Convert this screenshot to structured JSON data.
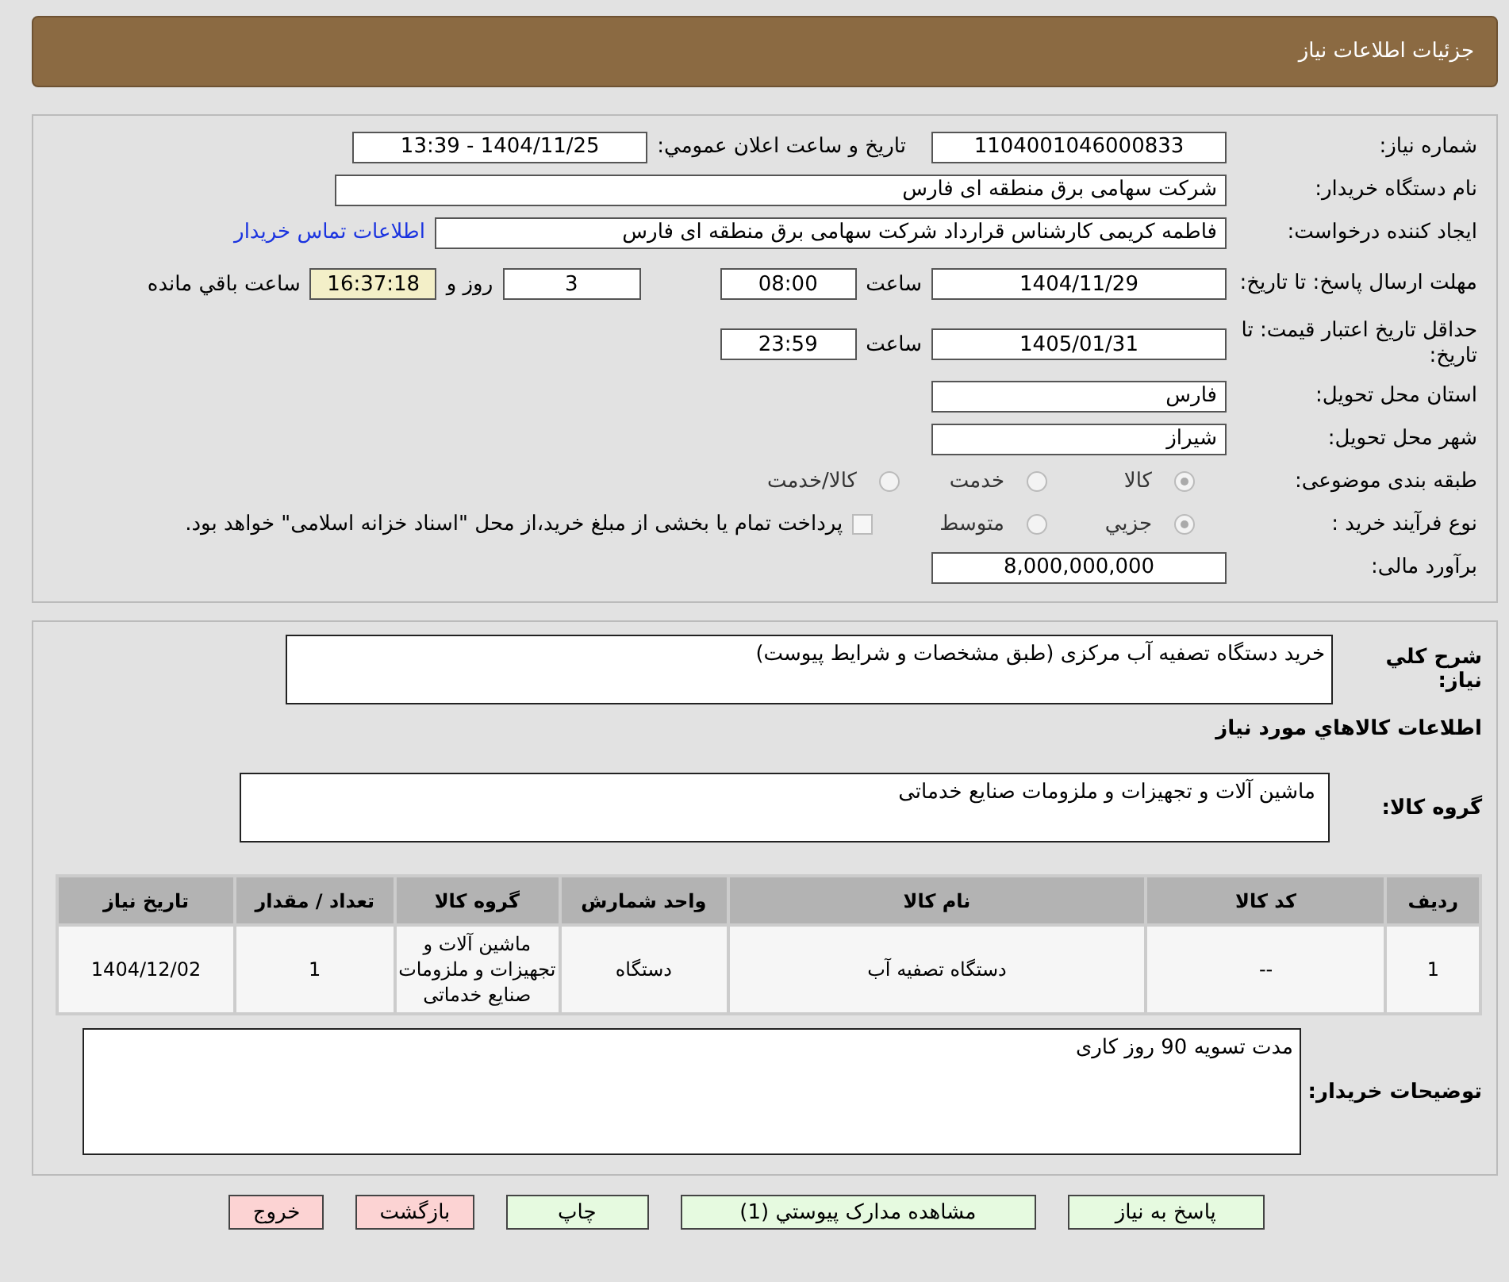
{
  "header": {
    "title": "جزئیات اطلاعات نیاز"
  },
  "need_number": {
    "label": "شماره نیاز:",
    "value": "1104001046000833"
  },
  "announce": {
    "label": "تاريخ و ساعت اعلان عمومي:",
    "value": "1404/11/25 - 13:39"
  },
  "buyer": {
    "label": "نام دستگاه خریدار:",
    "value": "شرکت سهامی برق منطقه ای فارس"
  },
  "creator": {
    "label": "ایجاد کننده درخواست:",
    "value": "فاطمه کریمی کارشناس قرارداد شرکت سهامی برق منطقه ای فارس",
    "link": "اطلاعات تماس خریدار"
  },
  "deadline": {
    "label": "مهلت ارسال پاسخ: تا تاریخ:",
    "date": "1404/11/29",
    "time_label": "ساعت",
    "time": "08:00",
    "days": "3",
    "days_label": "روز و",
    "remaining": "16:37:18",
    "remaining_label": "ساعت باقي مانده"
  },
  "validity": {
    "label": "حداقل تاریخ اعتبار قیمت: تا تاریخ:",
    "date": "1405/01/31",
    "time_label": "ساعت",
    "time": "23:59"
  },
  "province": {
    "label": "استان محل تحویل:",
    "value": "فارس"
  },
  "city": {
    "label": "شهر محل تحویل:",
    "value": "شیراز"
  },
  "category": {
    "label": "طبقه بندی موضوعی:",
    "options": [
      {
        "label": "کالا",
        "selected": true
      },
      {
        "label": "خدمت",
        "selected": false
      },
      {
        "label": "کالا/خدمت",
        "selected": false
      }
    ]
  },
  "process": {
    "label": "نوع فرآیند خرید :",
    "options": [
      {
        "label": "جزيي",
        "selected": true
      },
      {
        "label": "متوسط",
        "selected": false
      }
    ],
    "payment": {
      "checked": false,
      "text": "پرداخت تمام یا بخشی از مبلغ خرید،از محل \"اسناد خزانه اسلامی\" خواهد بود."
    }
  },
  "budget": {
    "label": "برآورد مالی:",
    "value": "8,000,000,000"
  },
  "description": {
    "label": "شرح كلي نياز:",
    "value": "خرید دستگاه تصفیه آب مرکزی (طبق مشخصات و شرایط پیوست)"
  },
  "goods_heading": "اطلاعات كالاهاي مورد نياز",
  "goods_group": {
    "label": "گروه کالا:",
    "value": "ماشین آلات و تجهیزات و ملزومات صنایع خدماتی"
  },
  "table": {
    "columns": [
      "ردیف",
      "کد کالا",
      "نام کالا",
      "واحد شمارش",
      "گروه کالا",
      "تعداد / مقدار",
      "تاریخ نیاز"
    ],
    "rows": [
      [
        "1",
        "--",
        "دستگاه تصفیه آب",
        "دستگاه",
        "ماشین آلات و تجهیزات و ملزومات صنایع خدماتی",
        "1",
        "1404/12/02"
      ]
    ]
  },
  "buyer_notes": {
    "label": "توضیحات خریدار:",
    "value": "مدت تسویه 90 روز کاری"
  },
  "buttons": [
    {
      "label": "پاسخ به نیاز",
      "kind": "action"
    },
    {
      "label": "مشاهده مدارک پیوستي (1)",
      "kind": "action"
    },
    {
      "label": "چاپ",
      "kind": "action"
    },
    {
      "label": "بازگشت",
      "kind": "cancel"
    },
    {
      "label": "خروج",
      "kind": "cancel"
    }
  ]
}
